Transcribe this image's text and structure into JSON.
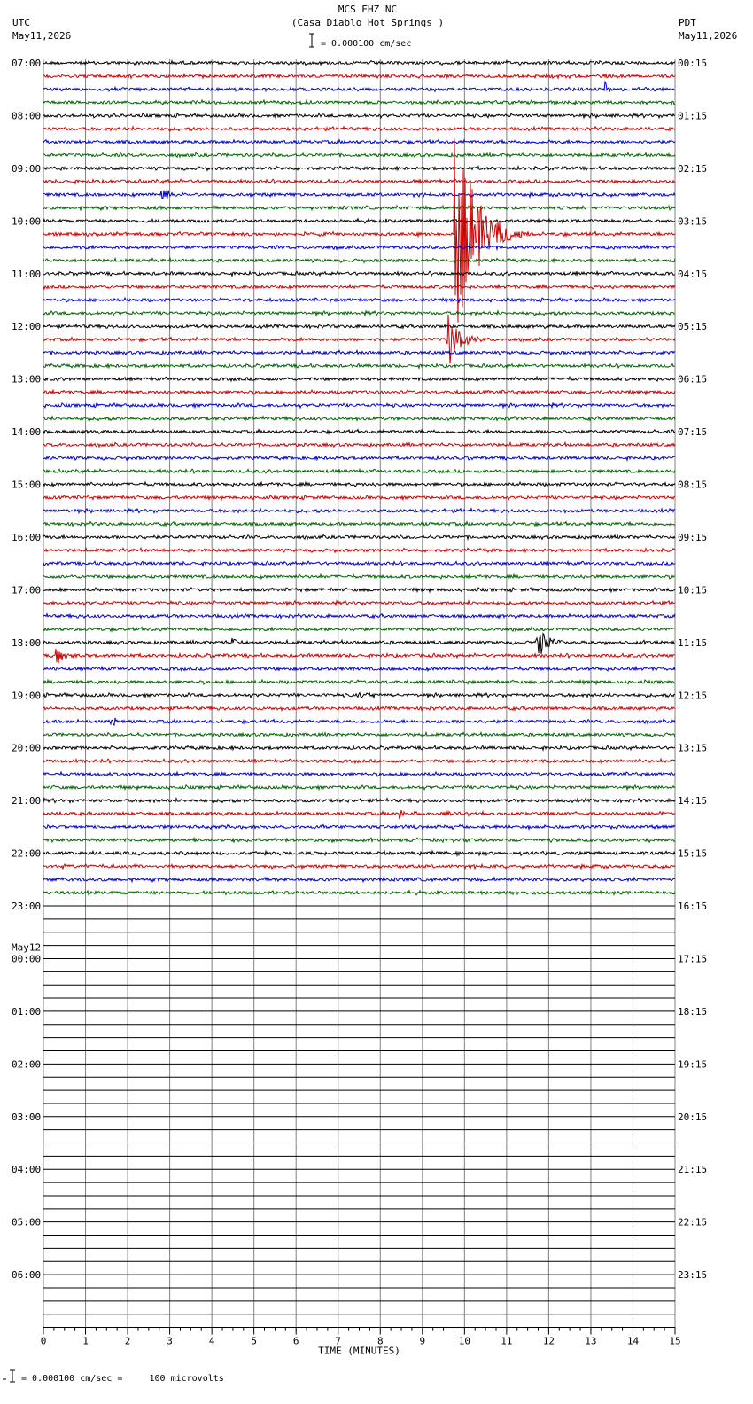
{
  "header": {
    "station": "MCS EHZ NC",
    "site": "(Casa Diablo Hot Springs )",
    "scale": "= 0.000100 cm/sec",
    "left_tz": "UTC",
    "left_date": "May11,2026",
    "right_tz": "PDT",
    "right_date": "May11,2026"
  },
  "footer": {
    "scale_note": "= 0.000100 cm/sec =     100 microvolts"
  },
  "colors": {
    "trace_cycle": [
      "#000000",
      "#cc0000",
      "#0000cc",
      "#006400"
    ],
    "grid": "#808080"
  },
  "chart_data": {
    "type": "helicorder",
    "xlabel": "TIME (MINUTES)",
    "xlim": [
      0,
      15
    ],
    "x_ticks": [
      "0",
      "1",
      "2",
      "3",
      "4",
      "5",
      "6",
      "7",
      "8",
      "9",
      "10",
      "11",
      "12",
      "13",
      "14",
      "15"
    ],
    "lines_total": 96,
    "lines_per_hour": 4,
    "lines_with_data": 64,
    "left_hour_labels": [
      "07:00",
      "08:00",
      "09:00",
      "10:00",
      "11:00",
      "12:00",
      "13:00",
      "14:00",
      "15:00",
      "16:00",
      "17:00",
      "18:00",
      "19:00",
      "20:00",
      "21:00",
      "22:00",
      "23:00",
      "00:00",
      "01:00",
      "02:00",
      "03:00",
      "04:00",
      "05:00",
      "06:00"
    ],
    "right_hour_labels": [
      "00:15",
      "01:15",
      "02:15",
      "03:15",
      "04:15",
      "05:15",
      "06:15",
      "07:15",
      "08:15",
      "09:15",
      "10:15",
      "11:15",
      "12:15",
      "13:15",
      "14:15",
      "15:15",
      "16:15",
      "17:15",
      "18:15",
      "19:15",
      "20:15",
      "21:15",
      "22:15",
      "23:15"
    ],
    "date_change": {
      "hour_index": 17,
      "label": "May12"
    },
    "events": [
      {
        "line": 2,
        "minute": 13.35,
        "amp": 9,
        "dur": 0.2
      },
      {
        "line": 10,
        "minute": 2.8,
        "amp": 7,
        "dur": 0.6
      },
      {
        "line": 13,
        "minute": 9.78,
        "amp": 115,
        "dur": 1.8
      },
      {
        "line": 21,
        "minute": 9.6,
        "amp": 32,
        "dur": 1.0
      },
      {
        "line": 44,
        "minute": 11.7,
        "amp": 22,
        "dur": 0.8
      },
      {
        "line": 45,
        "minute": 0.3,
        "amp": 8,
        "dur": 0.8
      },
      {
        "line": 50,
        "minute": 1.6,
        "amp": 6,
        "dur": 0.4
      },
      {
        "line": 57,
        "minute": 8.45,
        "amp": 8,
        "dur": 0.2
      },
      {
        "line": 48,
        "minute": 7.5,
        "amp": 4,
        "dur": 1.2
      },
      {
        "line": 44,
        "minute": 4.5,
        "amp": 6,
        "dur": 0.3
      }
    ]
  }
}
